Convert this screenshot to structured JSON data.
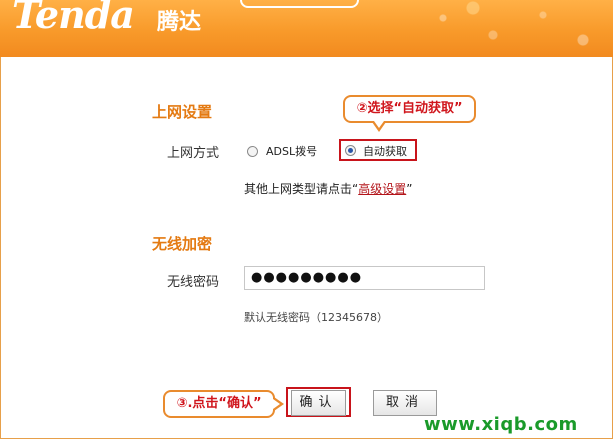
{
  "header": {
    "brand": "Tenda",
    "brand_cn": "腾达"
  },
  "colors": {
    "header": "#f89a2a",
    "title": "#e47a12",
    "highlight": "#c8141b",
    "link": "#b3141a"
  },
  "internet": {
    "title": "上网设置",
    "mode_label": "上网方式",
    "options": [
      {
        "label": "ADSL拨号",
        "selected": false
      },
      {
        "label": "自动获取",
        "selected": true
      }
    ],
    "advanced_prefix": "其他上网类型请点击“",
    "advanced_link": "高级设置",
    "advanced_suffix": "”"
  },
  "wireless": {
    "title": "无线加密",
    "password_label": "无线密码",
    "password_value": "●●●●●●●●●",
    "hint": "默认无线密码（12345678）"
  },
  "callouts": {
    "select": "②选择“自动获取”",
    "click": "③.点击“确认”"
  },
  "buttons": {
    "confirm": "确认",
    "cancel": "取消"
  },
  "watermark": "www.xiqb.com"
}
